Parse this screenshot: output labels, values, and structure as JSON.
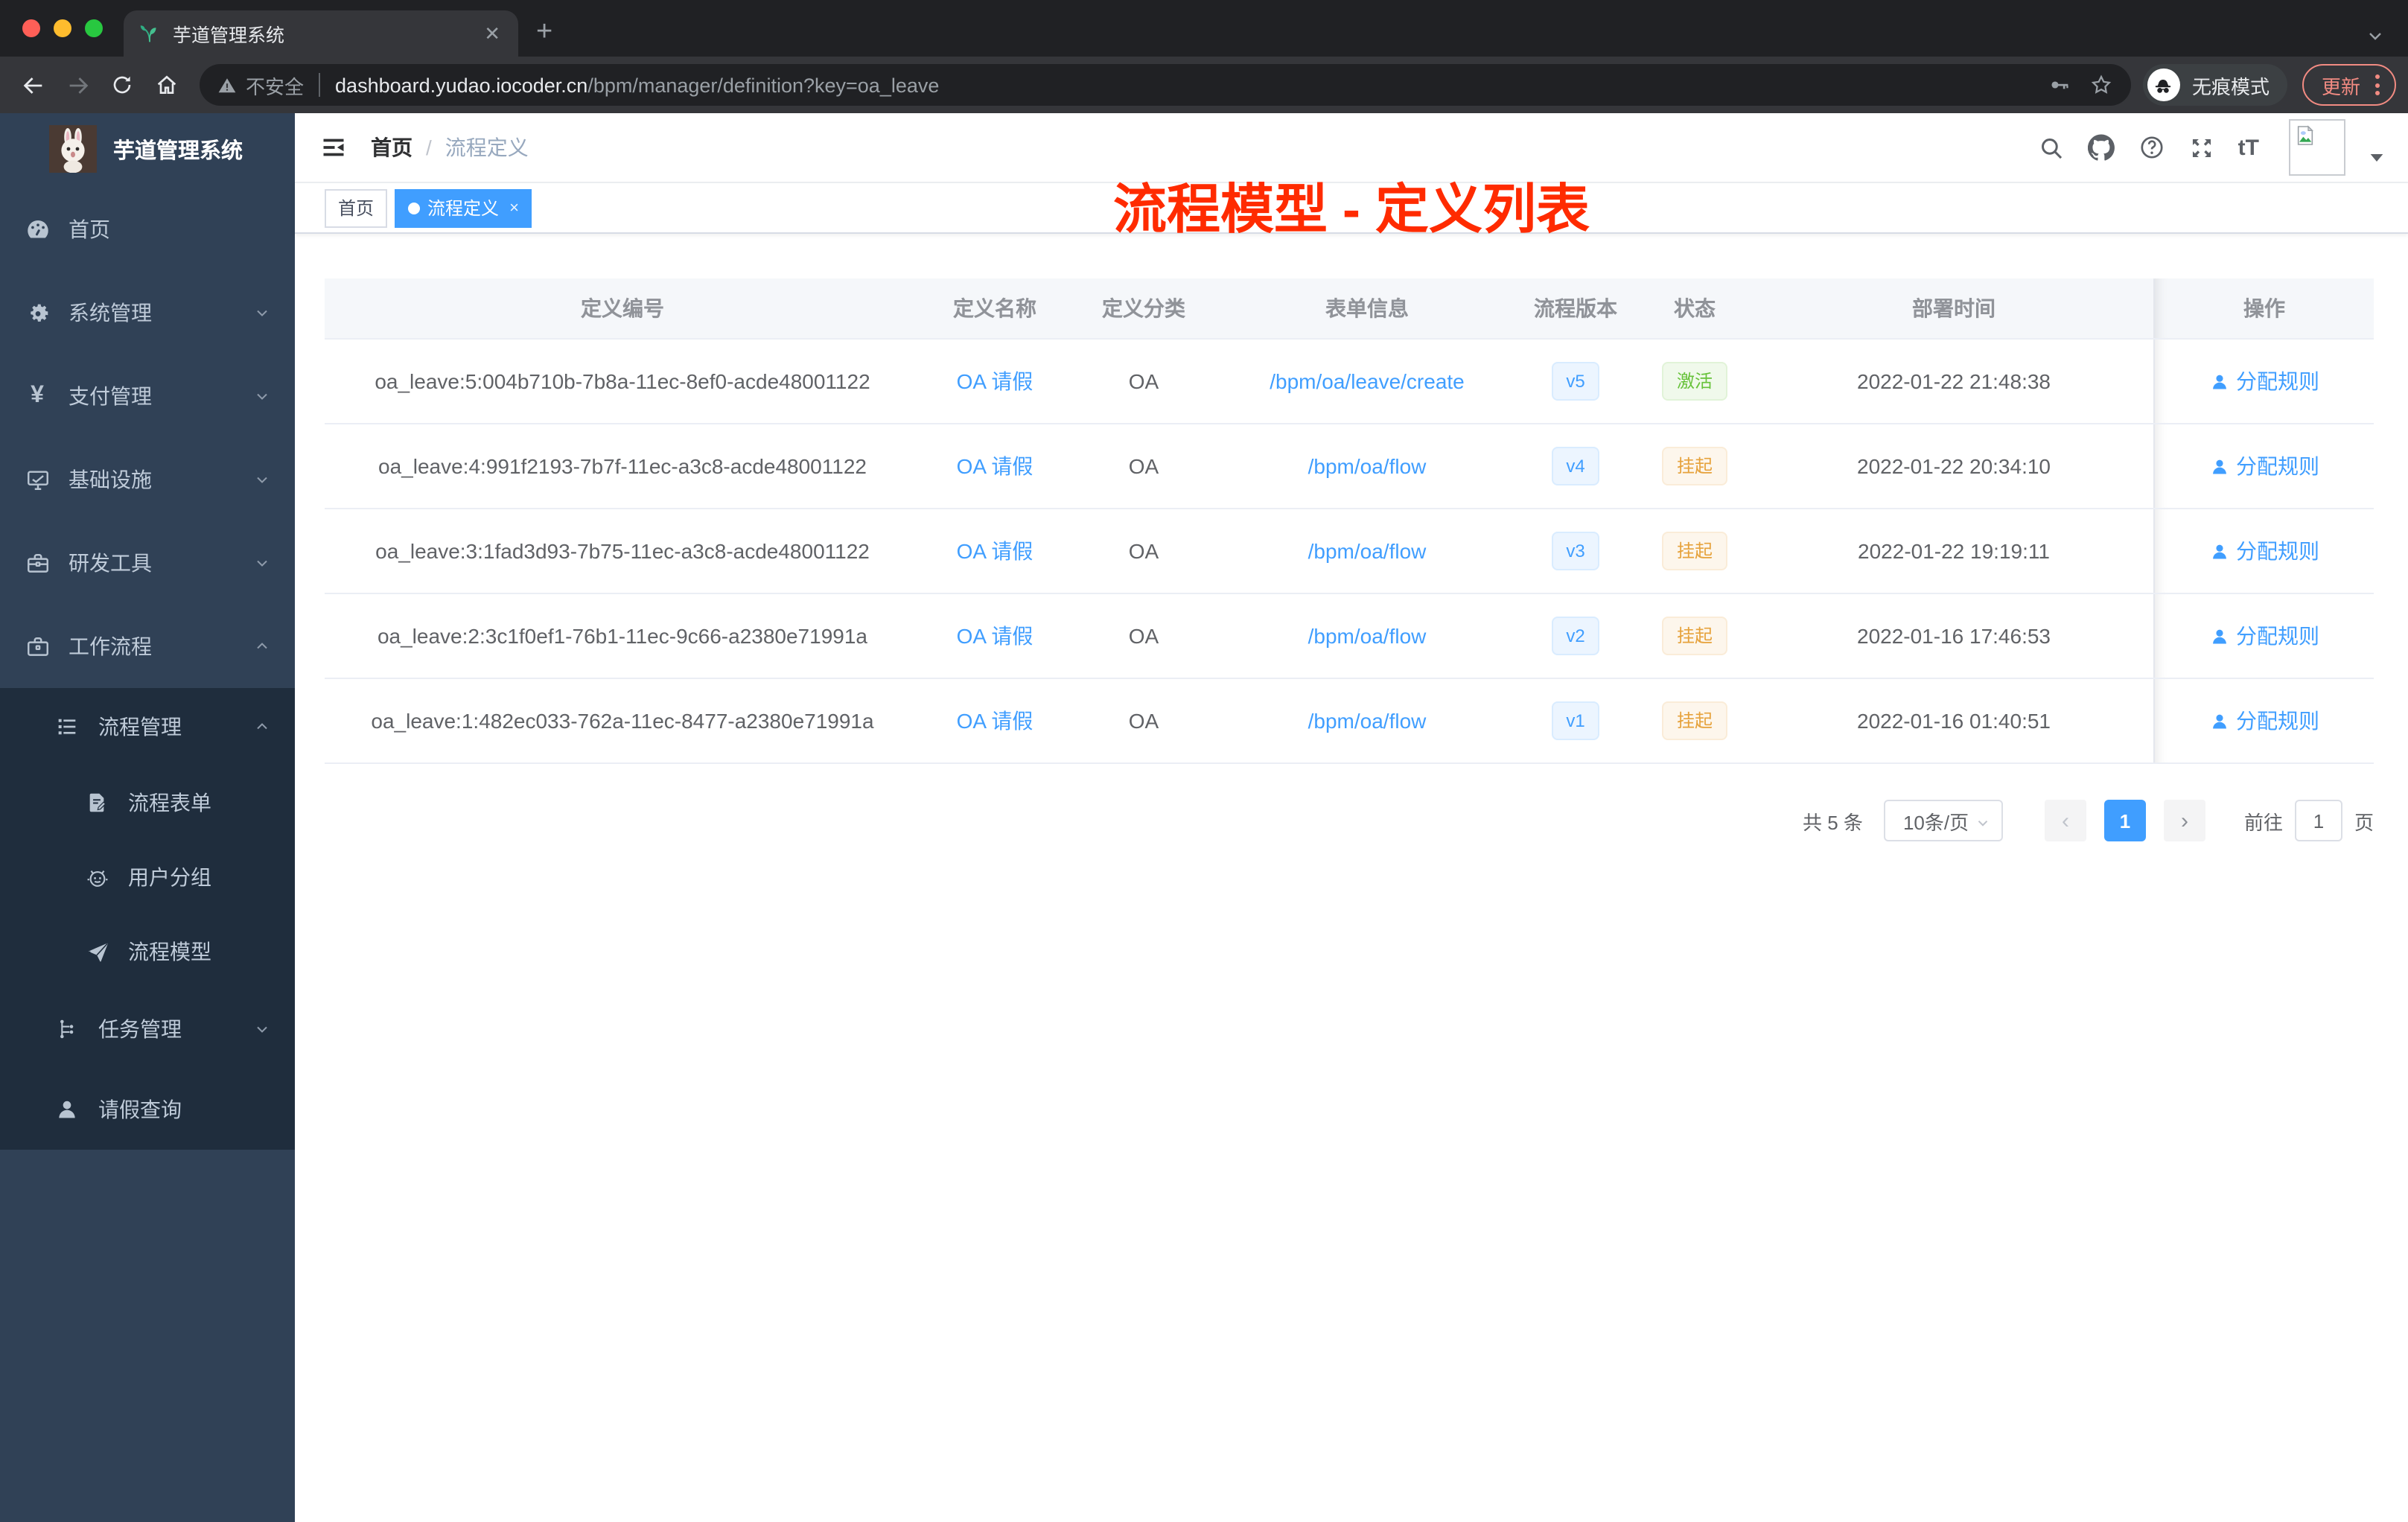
{
  "browser": {
    "tab_title": "芋道管理系统",
    "security_label": "不安全",
    "url_host": "dashboard.yudao.iocoder.cn",
    "url_path": "/bpm/manager/definition?key=oa_leave",
    "incognito_label": "无痕模式",
    "update_label": "更新"
  },
  "sidebar": {
    "logo_title": "芋道管理系统",
    "items": [
      {
        "label": "首页"
      },
      {
        "label": "系统管理"
      },
      {
        "label": "支付管理"
      },
      {
        "label": "基础设施"
      },
      {
        "label": "研发工具"
      },
      {
        "label": "工作流程"
      },
      {
        "label": "流程管理"
      },
      {
        "label": "流程表单"
      },
      {
        "label": "用户分组"
      },
      {
        "label": "流程模型"
      },
      {
        "label": "任务管理"
      },
      {
        "label": "请假查询"
      }
    ]
  },
  "header": {
    "breadcrumb": {
      "home": "首页",
      "separator": "/",
      "current": "流程定义"
    },
    "annotation": "流程模型 - 定义列表",
    "font_size_icon_glyph": "tT"
  },
  "tags": {
    "home": "首页",
    "active": "流程定义",
    "close_glyph": "×"
  },
  "table": {
    "columns": [
      "定义编号",
      "定义名称",
      "定义分类",
      "表单信息",
      "流程版本",
      "状态",
      "部署时间",
      "操作"
    ],
    "rows": [
      {
        "id": "oa_leave:5:004b710b-7b8a-11ec-8ef0-acde48001122",
        "name": "OA 请假",
        "category": "OA",
        "form": "/bpm/oa/leave/create",
        "version": "v5",
        "status": "激活",
        "status_type": "active",
        "time": "2022-01-22 21:48:38",
        "action": "分配规则"
      },
      {
        "id": "oa_leave:4:991f2193-7b7f-11ec-a3c8-acde48001122",
        "name": "OA 请假",
        "category": "OA",
        "form": "/bpm/oa/flow",
        "version": "v4",
        "status": "挂起",
        "status_type": "suspended",
        "time": "2022-01-22 20:34:10",
        "action": "分配规则"
      },
      {
        "id": "oa_leave:3:1fad3d93-7b75-11ec-a3c8-acde48001122",
        "name": "OA 请假",
        "category": "OA",
        "form": "/bpm/oa/flow",
        "version": "v3",
        "status": "挂起",
        "status_type": "suspended",
        "time": "2022-01-22 19:19:11",
        "action": "分配规则"
      },
      {
        "id": "oa_leave:2:3c1f0ef1-76b1-11ec-9c66-a2380e71991a",
        "name": "OA 请假",
        "category": "OA",
        "form": "/bpm/oa/flow",
        "version": "v2",
        "status": "挂起",
        "status_type": "suspended",
        "time": "2022-01-16 17:46:53",
        "action": "分配规则"
      },
      {
        "id": "oa_leave:1:482ec033-762a-11ec-8477-a2380e71991a",
        "name": "OA 请假",
        "category": "OA",
        "form": "/bpm/oa/flow",
        "version": "v1",
        "status": "挂起",
        "status_type": "suspended",
        "time": "2022-01-16 01:40:51",
        "action": "分配规则"
      }
    ]
  },
  "pagination": {
    "total_label": "共 5 条",
    "page_size": "10条/页",
    "prev_glyph": "‹",
    "current_page": "1",
    "next_glyph": "›",
    "goto_label": "前往",
    "goto_value": "1",
    "page_unit": "页"
  },
  "colors": {
    "accent": "#409eff",
    "success": "#67c23a",
    "warning": "#e6a23c",
    "annotation_red": "#ff2b00",
    "sidebar_bg": "#304156",
    "sidebar_submenu_bg": "#1f2d3d",
    "chrome_dark": "#202124",
    "chrome_toolbar": "#35363a"
  }
}
